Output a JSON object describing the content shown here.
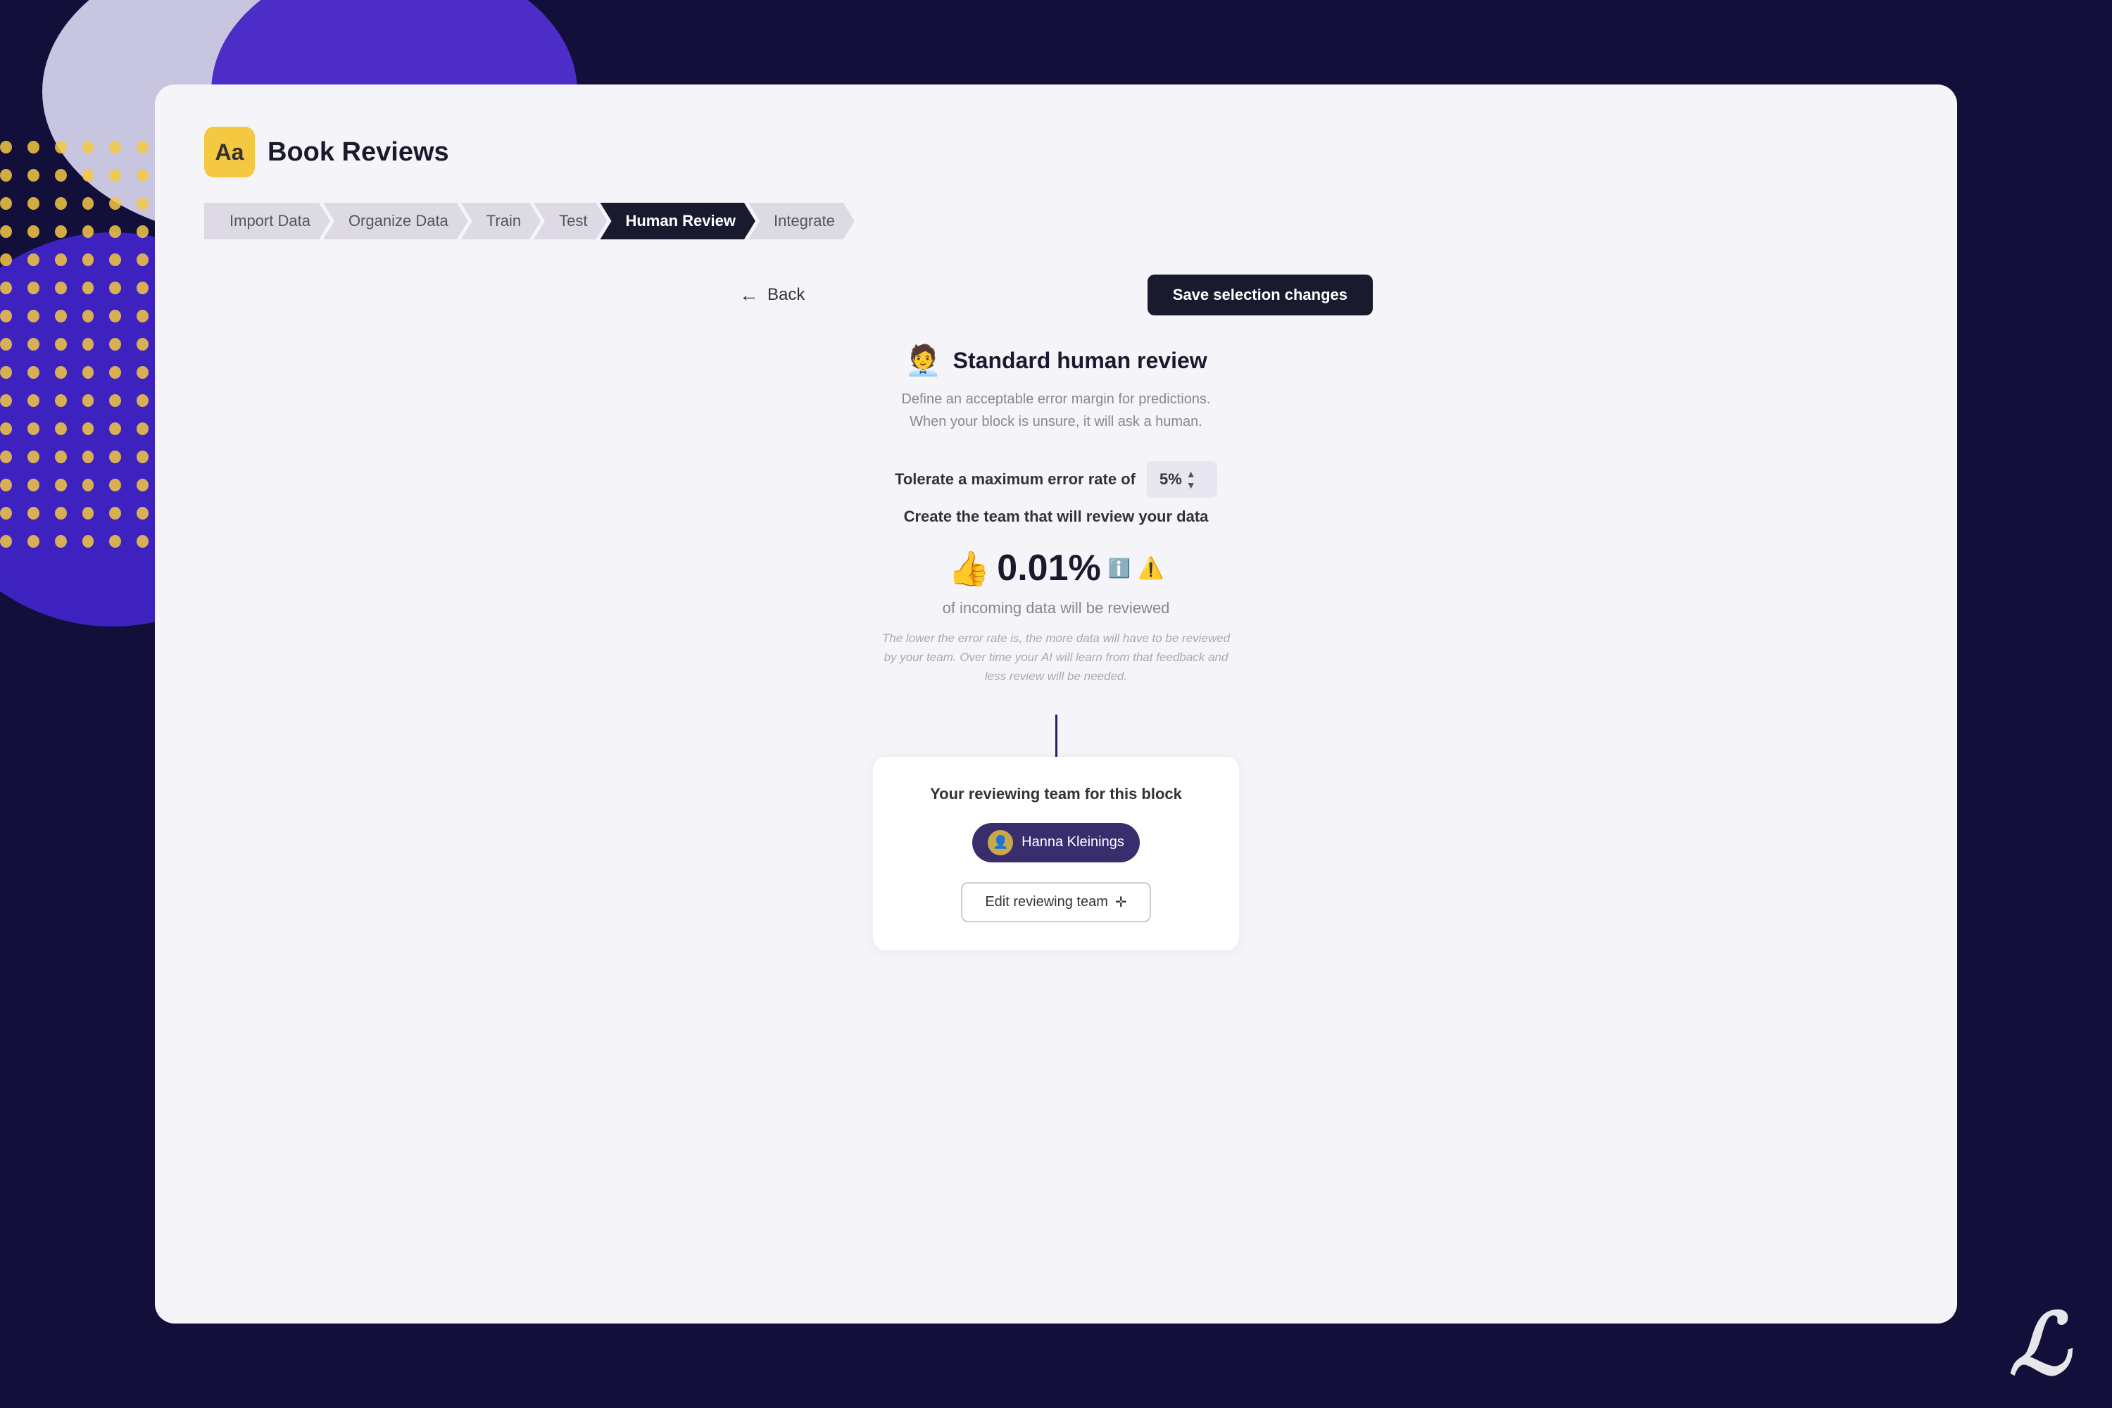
{
  "background": {
    "colors": {
      "main": "#12103a",
      "card": "#f5f4f8",
      "circle1": "#c8c5e0",
      "circle2": "#4c2dc8",
      "circle3": "#3d22c0",
      "dots": "#f5c842"
    }
  },
  "app": {
    "icon_text": "Aa",
    "title": "Book Reviews"
  },
  "steps": [
    {
      "label": "Import Data",
      "active": false
    },
    {
      "label": "Organize Data",
      "active": false
    },
    {
      "label": "Train",
      "active": false
    },
    {
      "label": "Test",
      "active": false
    },
    {
      "label": "Human Review",
      "active": true
    },
    {
      "label": "Integrate",
      "active": false
    }
  ],
  "toolbar": {
    "back_label": "Back",
    "save_label": "Save selection changes"
  },
  "section": {
    "icon": "🧑‍💼",
    "title": "Standard human review",
    "description_line1": "Define an acceptable error margin for predictions.",
    "description_line2": "When your block is unsure, it will ask a human."
  },
  "error_rate": {
    "label": "Tolerate a maximum error rate of",
    "value": "5%",
    "create_team_label": "Create the team that will review your data"
  },
  "stats": {
    "thumb_icon": "👍",
    "percentage": "0.01%",
    "info_icon": "ℹ️",
    "warning_icon": "⚠️",
    "subtitle": "of incoming data will be reviewed",
    "footnote": "The lower the error rate is, the more data will have to be reviewed by your team. Over time your AI will learn from that feedback and less review will be needed."
  },
  "team_box": {
    "title": "Your reviewing team for this block",
    "member": {
      "avatar_emoji": "👤",
      "name": "Hanna Kleinings"
    },
    "edit_button_label": "Edit reviewing team",
    "edit_icon": "✛"
  },
  "logo": "ℒ"
}
